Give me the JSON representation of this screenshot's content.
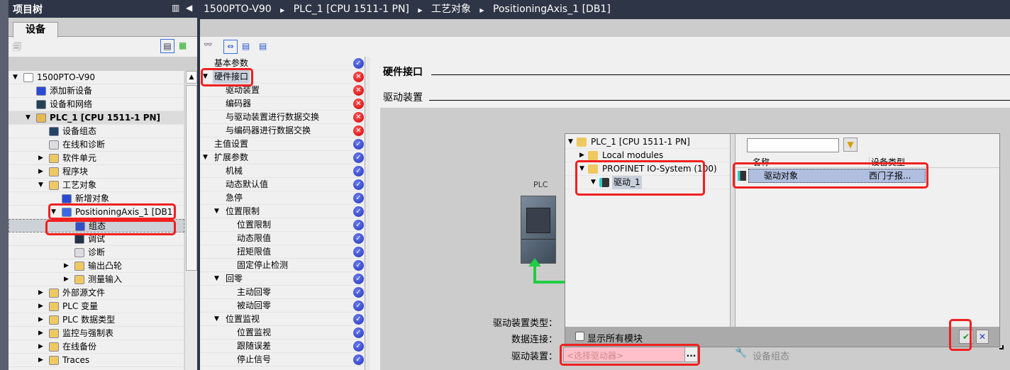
{
  "project_tree": {
    "title": "项目树",
    "tab": "设备",
    "items": [
      {
        "label": "1500PTO-V90",
        "level": 0,
        "arrow": "down",
        "icon": "project-icon"
      },
      {
        "label": "添加新设备",
        "level": 1,
        "arrow": "",
        "icon": "add-device-icon"
      },
      {
        "label": "设备和网络",
        "level": 1,
        "arrow": "",
        "icon": "network-icon"
      },
      {
        "label": "PLC_1 [CPU 1511-1 PN]",
        "level": 1,
        "arrow": "down",
        "icon": "plc-folder-icon",
        "highlight": true
      },
      {
        "label": "设备组态",
        "level": 2,
        "arrow": "",
        "icon": "device-config-icon"
      },
      {
        "label": "在线和诊断",
        "level": 2,
        "arrow": "",
        "icon": "diagnostics-icon"
      },
      {
        "label": "软件单元",
        "level": 2,
        "arrow": "right",
        "icon": "folder-icon"
      },
      {
        "label": "程序块",
        "level": 2,
        "arrow": "right",
        "icon": "folder-icon"
      },
      {
        "label": "工艺对象",
        "level": 2,
        "arrow": "down",
        "icon": "folder-icon"
      },
      {
        "label": "新增对象",
        "level": 3,
        "arrow": "",
        "icon": "add-object-icon"
      },
      {
        "label": "PositioningAxis_1 [DB1]",
        "level": 3,
        "arrow": "down",
        "icon": "axis-icon"
      },
      {
        "label": "组态",
        "level": 4,
        "arrow": "",
        "icon": "configuration-icon",
        "selected": true
      },
      {
        "label": "调试",
        "level": 4,
        "arrow": "",
        "icon": "commissioning-icon"
      },
      {
        "label": "诊断",
        "level": 4,
        "arrow": "",
        "icon": "diagnostics-icon"
      },
      {
        "label": "输出凸轮",
        "level": 4,
        "arrow": "right",
        "icon": "folder-icon"
      },
      {
        "label": "测量输入",
        "level": 4,
        "arrow": "right",
        "icon": "folder-icon"
      },
      {
        "label": "外部源文件",
        "level": 2,
        "arrow": "right",
        "icon": "folder-icon"
      },
      {
        "label": "PLC 变量",
        "level": 2,
        "arrow": "right",
        "icon": "folder-icon"
      },
      {
        "label": "PLC 数据类型",
        "level": 2,
        "arrow": "right",
        "icon": "folder-icon"
      },
      {
        "label": "监控与强制表",
        "level": 2,
        "arrow": "right",
        "icon": "folder-icon"
      },
      {
        "label": "在线备份",
        "level": 2,
        "arrow": "right",
        "icon": "folder-icon"
      },
      {
        "label": "Traces",
        "level": 2,
        "arrow": "right",
        "icon": "folder-icon"
      }
    ]
  },
  "breadcrumb": [
    "1500PTO-V90",
    "PLC_1 [CPU 1511-1 PN]",
    "工艺对象",
    "PositioningAxis_1 [DB1]"
  ],
  "nav": {
    "items": [
      {
        "label": "基本参数",
        "level": 0,
        "arrow": "",
        "status": "ok"
      },
      {
        "label": "硬件接口",
        "level": 0,
        "arrow": "down",
        "status": "error",
        "selected": true
      },
      {
        "label": "驱动装置",
        "level": 1,
        "arrow": "",
        "status": "error"
      },
      {
        "label": "编码器",
        "level": 1,
        "arrow": "",
        "status": "error"
      },
      {
        "label": "与驱动装置进行数据交换",
        "level": 1,
        "arrow": "",
        "status": "error"
      },
      {
        "label": "与编码器进行数据交换",
        "level": 1,
        "arrow": "",
        "status": "error"
      },
      {
        "label": "主值设置",
        "level": 0,
        "arrow": "",
        "status": "ok"
      },
      {
        "label": "扩展参数",
        "level": 0,
        "arrow": "down",
        "status": "ok"
      },
      {
        "label": "机械",
        "level": 1,
        "arrow": "",
        "status": "ok"
      },
      {
        "label": "动态默认值",
        "level": 1,
        "arrow": "",
        "status": "ok"
      },
      {
        "label": "急停",
        "level": 1,
        "arrow": "",
        "status": "ok"
      },
      {
        "label": "位置限制",
        "level": 1,
        "arrow": "down",
        "status": "ok"
      },
      {
        "label": "位置限制",
        "level": 2,
        "arrow": "",
        "status": "ok"
      },
      {
        "label": "动态限值",
        "level": 2,
        "arrow": "",
        "status": "ok"
      },
      {
        "label": "扭矩限值",
        "level": 2,
        "arrow": "",
        "status": "ok"
      },
      {
        "label": "固定停止检测",
        "level": 2,
        "arrow": "",
        "status": "ok"
      },
      {
        "label": "回零",
        "level": 1,
        "arrow": "down",
        "status": "ok"
      },
      {
        "label": "主动回零",
        "level": 2,
        "arrow": "",
        "status": "ok"
      },
      {
        "label": "被动回零",
        "level": 2,
        "arrow": "",
        "status": "ok"
      },
      {
        "label": "位置监视",
        "level": 1,
        "arrow": "down",
        "status": "ok"
      },
      {
        "label": "位置监视",
        "level": 2,
        "arrow": "",
        "status": "ok"
      },
      {
        "label": "跟随误差",
        "level": 2,
        "arrow": "",
        "status": "ok"
      },
      {
        "label": "停止信号",
        "level": 2,
        "arrow": "",
        "status": "ok"
      }
    ]
  },
  "main": {
    "section_title": "硬件接口",
    "subsection_title": "驱动装置",
    "plc_label": "PLC",
    "drive_type_label": "驱动装置类型：",
    "data_connection_label": "数据连接：",
    "drive_label": "驱动装置：",
    "drive_placeholder": "<选择驱动器>",
    "browse_label": "...",
    "device_config_label": "设备组态"
  },
  "dialog": {
    "tree": [
      {
        "label": "PLC_1 [CPU 1511-1 PN]",
        "level": 0,
        "arrow": "down"
      },
      {
        "label": "Local modules",
        "level": 1,
        "arrow": "right"
      },
      {
        "label": "PROFINET IO-System (100)",
        "level": 1,
        "arrow": "down"
      },
      {
        "label": "驱动_1",
        "level": 2,
        "arrow": "down",
        "selected": true
      }
    ],
    "filter_value": "",
    "columns": [
      "名称",
      "设备类型"
    ],
    "rows": [
      {
        "name": "驱动对象",
        "type": "西门子报..."
      }
    ],
    "show_all_label": "显示所有模块",
    "show_all_checked": false
  },
  "colors": {
    "highlight": "#f02020",
    "error": "#cc0000",
    "ok": "#2233b8",
    "header": "#2e3546",
    "input_error_bg": "#ffc0cb"
  }
}
